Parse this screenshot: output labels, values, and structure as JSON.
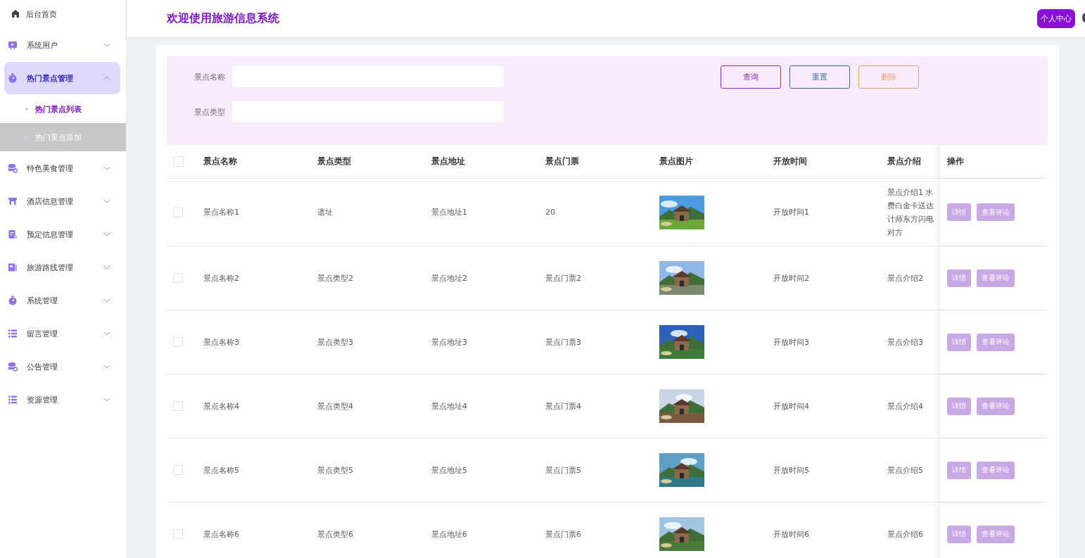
{
  "sidebar": {
    "home": {
      "label": "后台首页"
    },
    "items": [
      {
        "label": "系统用户",
        "expanded": false,
        "selected": false
      },
      {
        "label": "热门景点管理",
        "expanded": true,
        "selected": true,
        "children": [
          {
            "label": "热门景点列表",
            "selected": true,
            "hovered": false
          },
          {
            "label": "热门景点添加",
            "selected": false,
            "hovered": true
          }
        ]
      },
      {
        "label": "特色美食管理",
        "expanded": false,
        "selected": false
      },
      {
        "label": "酒店信息管理",
        "expanded": false,
        "selected": false
      },
      {
        "label": "预定信息管理",
        "expanded": false,
        "selected": false
      },
      {
        "label": "旅游路线管理",
        "expanded": false,
        "selected": false
      },
      {
        "label": "系统管理",
        "expanded": false,
        "selected": false
      },
      {
        "label": "留言管理",
        "expanded": false,
        "selected": false
      },
      {
        "label": "公告管理",
        "expanded": false,
        "selected": false
      },
      {
        "label": "资源管理",
        "expanded": false,
        "selected": false
      }
    ]
  },
  "header": {
    "title": "欢迎使用旅游信息系统",
    "user_button": "个人中心"
  },
  "filters": [
    {
      "label": "景点名称"
    },
    {
      "label": "景点类型"
    }
  ],
  "buttons": [
    {
      "label": "查询",
      "kind": "query"
    },
    {
      "label": "重置",
      "kind": "reset"
    },
    {
      "label": "删除",
      "kind": "delete"
    }
  ],
  "table": {
    "select_all": {
      "checked": false
    },
    "columns": [
      "景点名称",
      "景点类型",
      "景点地址",
      "景点门票",
      "景点图片",
      "开放时间",
      "景点介绍",
      "操作"
    ],
    "rows": [
      {
        "checked": false,
        "cells": [
          "景点名称1",
          "遗址",
          "景点地址1",
          "20",
          {
            "kind": "picture"
          },
          "开放时间1",
          "景点介绍1 水费白金卡送达计师东方闪电对方"
        ],
        "actions": [
          "详情",
          "查看评论"
        ]
      },
      {
        "checked": false,
        "cells": [
          "景点名称2",
          "景点类型2",
          "景点地址2",
          "景点门票2",
          {
            "kind": "picture"
          },
          "开放时间2",
          "景点介绍2"
        ],
        "actions": [
          "详情",
          "查看评论"
        ]
      },
      {
        "checked": false,
        "cells": [
          "景点名称3",
          "景点类型3",
          "景点地址3",
          "景点门票3",
          {
            "kind": "picture"
          },
          "开放时间3",
          "景点介绍3"
        ],
        "actions": [
          "详情",
          "查看评论"
        ]
      },
      {
        "checked": false,
        "cells": [
          "景点名称4",
          "景点类型4",
          "景点地址4",
          "景点门票4",
          {
            "kind": "picture"
          },
          "开放时间4",
          "景点介绍4"
        ],
        "actions": [
          "详情",
          "查看评论"
        ]
      },
      {
        "checked": false,
        "cells": [
          "景点名称5",
          "景点类型5",
          "景点地址5",
          "景点门票5",
          {
            "kind": "picture"
          },
          "开放时间5",
          "景点介绍5"
        ],
        "actions": [
          "详情",
          "查看评论"
        ]
      },
      {
        "checked": false,
        "cells": [
          "景点名称6",
          "景点类型6",
          "景点地址6",
          "景点门票6",
          {
            "kind": "picture"
          },
          "开放时间6",
          "景点介绍6"
        ],
        "actions": [
          "详情",
          "查看评论"
        ]
      }
    ]
  }
}
